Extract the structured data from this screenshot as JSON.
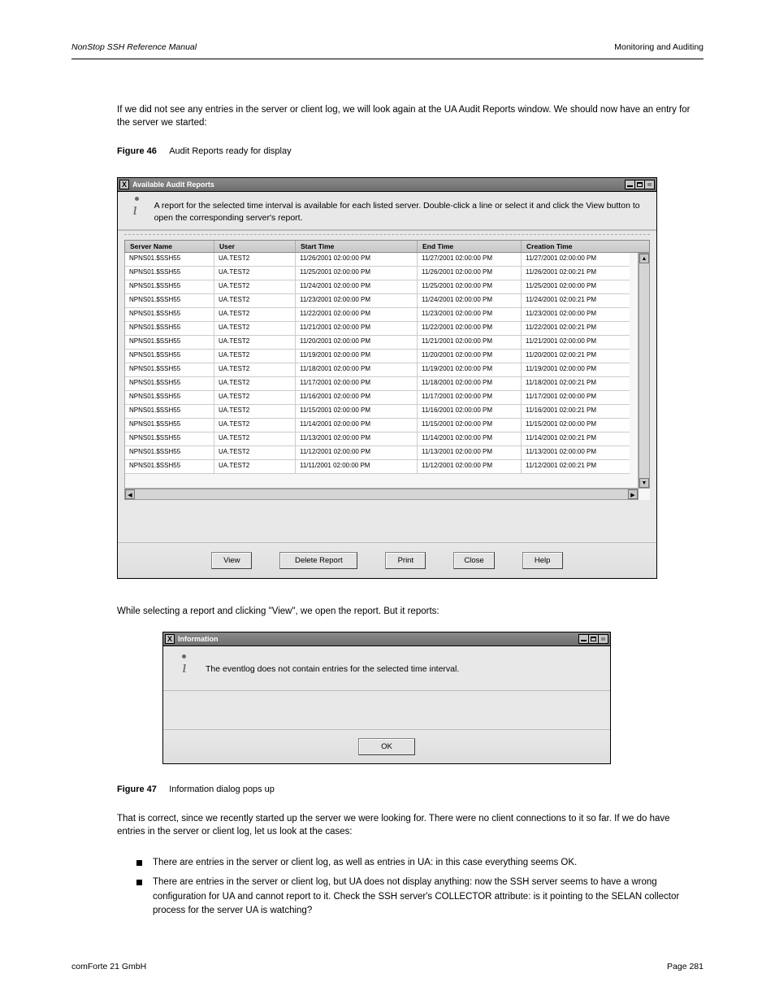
{
  "header": {
    "left": "NonStop SSH Reference Manual",
    "right": "Monitoring and Auditing"
  },
  "para1": "If we did not see any entries in the server or client log, we will look again at the UA Audit Reports window. We should now have an entry for the server we started:",
  "fig1_label": "Figure 46",
  "fig1_text": "Audit Reports ready for display",
  "win1": {
    "title": "Available Audit Reports",
    "info": "A report for the selected time interval is available for each listed server. Double-click a line or select it and click the View button to open the corresponding server's report.",
    "columns": [
      "Server Name",
      "User",
      "Start Time",
      "End Time",
      "Creation Time"
    ],
    "rows": [
      [
        "NPNS01.$SSH55",
        "UA.TEST2",
        "11/26/2001 02:00:00 PM",
        "11/27/2001 02:00:00 PM",
        "11/27/2001 02:00:00 PM"
      ],
      [
        "NPNS01.$SSH55",
        "UA.TEST2",
        "11/25/2001 02:00:00 PM",
        "11/26/2001 02:00:00 PM",
        "11/26/2001 02:00:21 PM"
      ],
      [
        "NPNS01.$SSH55",
        "UA.TEST2",
        "11/24/2001 02:00:00 PM",
        "11/25/2001 02:00:00 PM",
        "11/25/2001 02:00:00 PM"
      ],
      [
        "NPNS01.$SSH55",
        "UA.TEST2",
        "11/23/2001 02:00:00 PM",
        "11/24/2001 02:00:00 PM",
        "11/24/2001 02:00:21 PM"
      ],
      [
        "NPNS01.$SSH55",
        "UA.TEST2",
        "11/22/2001 02:00:00 PM",
        "11/23/2001 02:00:00 PM",
        "11/23/2001 02:00:00 PM"
      ],
      [
        "NPNS01.$SSH55",
        "UA.TEST2",
        "11/21/2001 02:00:00 PM",
        "11/22/2001 02:00:00 PM",
        "11/22/2001 02:00:21 PM"
      ],
      [
        "NPNS01.$SSH55",
        "UA.TEST2",
        "11/20/2001 02:00:00 PM",
        "11/21/2001 02:00:00 PM",
        "11/21/2001 02:00:00 PM"
      ],
      [
        "NPNS01.$SSH55",
        "UA.TEST2",
        "11/19/2001 02:00:00 PM",
        "11/20/2001 02:00:00 PM",
        "11/20/2001 02:00:21 PM"
      ],
      [
        "NPNS01.$SSH55",
        "UA.TEST2",
        "11/18/2001 02:00:00 PM",
        "11/19/2001 02:00:00 PM",
        "11/19/2001 02:00:00 PM"
      ],
      [
        "NPNS01.$SSH55",
        "UA.TEST2",
        "11/17/2001 02:00:00 PM",
        "11/18/2001 02:00:00 PM",
        "11/18/2001 02:00:21 PM"
      ],
      [
        "NPNS01.$SSH55",
        "UA.TEST2",
        "11/16/2001 02:00:00 PM",
        "11/17/2001 02:00:00 PM",
        "11/17/2001 02:00:00 PM"
      ],
      [
        "NPNS01.$SSH55",
        "UA.TEST2",
        "11/15/2001 02:00:00 PM",
        "11/16/2001 02:00:00 PM",
        "11/16/2001 02:00:21 PM"
      ],
      [
        "NPNS01.$SSH55",
        "UA.TEST2",
        "11/14/2001 02:00:00 PM",
        "11/15/2001 02:00:00 PM",
        "11/15/2001 02:00:00 PM"
      ],
      [
        "NPNS01.$SSH55",
        "UA.TEST2",
        "11/13/2001 02:00:00 PM",
        "11/14/2001 02:00:00 PM",
        "11/14/2001 02:00:21 PM"
      ],
      [
        "NPNS01.$SSH55",
        "UA.TEST2",
        "11/12/2001 02:00:00 PM",
        "11/13/2001 02:00:00 PM",
        "11/13/2001 02:00:00 PM"
      ],
      [
        "NPNS01.$SSH55",
        "UA.TEST2",
        "11/11/2001 02:00:00 PM",
        "11/12/2001 02:00:00 PM",
        "11/12/2001 02:00:21 PM"
      ]
    ],
    "buttons": {
      "view": "View",
      "delete": "Delete Report",
      "print": "Print",
      "close": "Close",
      "help": "Help"
    }
  },
  "para2": "While selecting a report and clicking \"View\", we open the report. But it reports:",
  "win2": {
    "title": "Information",
    "info": "The eventlog does not contain entries for the selected time interval.",
    "ok": "OK"
  },
  "fig2_label": "Figure 47",
  "fig2_text": "Information dialog pops up",
  "para3": "That is correct, since we recently started up the server we were looking for. There were no client connections to it so far. If we do have entries in the server or client log, let us look at the cases:",
  "bullets": [
    "There are entries in the server or client log, as well as entries in UA: in this case everything seems OK.",
    "There are entries in the server or client log, but UA does not display anything: now the SSH server seems to have a wrong configuration for UA and cannot report to it. Check the SSH server's COLLECTOR attribute: is it pointing to the SELAN collector process for the server UA is watching?"
  ],
  "footer": {
    "company": "comForte 21 GmbH",
    "page": "Page 281"
  }
}
